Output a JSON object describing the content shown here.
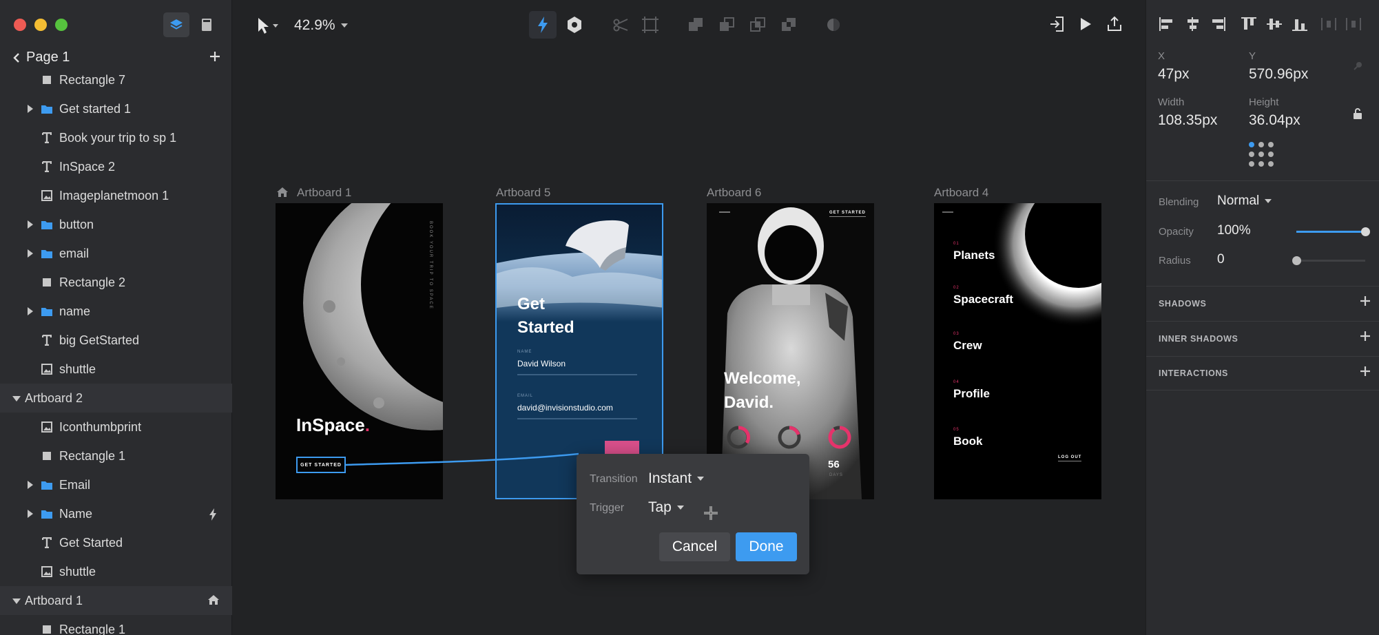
{
  "toolbar": {
    "zoom": "42.9%"
  },
  "sidebar": {
    "page_title": "Page 1",
    "layers": [
      {
        "label": "Rectangle 7",
        "icon": "rectangle-icon"
      },
      {
        "label": "Get started 1",
        "icon": "folder-icon"
      },
      {
        "label": "Book your trip to sp 1",
        "icon": "text-icon"
      },
      {
        "label": "InSpace 2",
        "icon": "text-icon"
      },
      {
        "label": "Imageplanetmoon 1",
        "icon": "image-icon"
      },
      {
        "label": "button",
        "icon": "folder-icon"
      },
      {
        "label": "email",
        "icon": "folder-icon"
      },
      {
        "label": "Rectangle 2",
        "icon": "rectangle-icon"
      },
      {
        "label": "name",
        "icon": "folder-icon"
      },
      {
        "label": "big GetStarted",
        "icon": "text-icon"
      },
      {
        "label": "shuttle",
        "icon": "image-icon"
      },
      {
        "label": "Artboard 2",
        "icon": "artboard-group"
      },
      {
        "label": "Iconthumbprint",
        "icon": "image-icon"
      },
      {
        "label": "Rectangle 1",
        "icon": "rectangle-icon"
      },
      {
        "label": "Email",
        "icon": "folder-icon"
      },
      {
        "label": "Name",
        "icon": "folder-icon"
      },
      {
        "label": "Get Started",
        "icon": "text-icon"
      },
      {
        "label": "shuttle",
        "icon": "image-icon"
      },
      {
        "label": "Artboard 1",
        "icon": "artboard-group"
      },
      {
        "label": "Rectangle 1",
        "icon": "rectangle-icon"
      }
    ]
  },
  "canvas": {
    "artboards": [
      {
        "label": "Artboard 1"
      },
      {
        "label": "Artboard 5"
      },
      {
        "label": "Artboard 6"
      },
      {
        "label": "Artboard 4"
      }
    ],
    "ab1": {
      "vertical_text": "BOOK YOUR TRIP TO SPACE",
      "brand": "InSpace",
      "brand_dot": ".",
      "cta": "GET STARTED"
    },
    "ab5": {
      "title_line1": "Get",
      "title_line2": "Started",
      "name_label": "NAME",
      "name_value": "David Wilson",
      "email_label": "EMAIL",
      "email_value": "david@invisionstudio.com"
    },
    "ab6": {
      "top_link": "GET STARTED",
      "welcome_line1": "Welcome,",
      "welcome_line2": "David.",
      "stat_value": "56",
      "stat_unit": "DAYS"
    },
    "ab4": {
      "menu": [
        {
          "num": "01",
          "label": "Planets"
        },
        {
          "num": "02",
          "label": "Spacecraft"
        },
        {
          "num": "03",
          "label": "Crew"
        },
        {
          "num": "04",
          "label": "Profile"
        },
        {
          "num": "05",
          "label": "Book"
        }
      ],
      "logout": "LOG OUT"
    }
  },
  "popup": {
    "transition_label": "Transition",
    "transition_value": "Instant",
    "trigger_label": "Trigger",
    "trigger_value": "Tap",
    "cancel": "Cancel",
    "done": "Done"
  },
  "inspector": {
    "x_label": "X",
    "x_value": "47px",
    "y_label": "Y",
    "y_value": "570.96px",
    "width_label": "Width",
    "width_value": "108.35px",
    "height_label": "Height",
    "height_value": "36.04px",
    "blending_label": "Blending",
    "blending_value": "Normal",
    "opacity_label": "Opacity",
    "opacity_value": "100%",
    "opacity_fraction": 1.0,
    "radius_label": "Radius",
    "radius_value": "0",
    "radius_fraction": 0.0,
    "sections": [
      "SHADOWS",
      "INNER SHADOWS",
      "INTERACTIONS"
    ]
  },
  "colors": {
    "accent": "#3d9bf0",
    "brand_pink": "#e5336b",
    "panel": "#2b2c2f",
    "canvas": "#222325"
  }
}
